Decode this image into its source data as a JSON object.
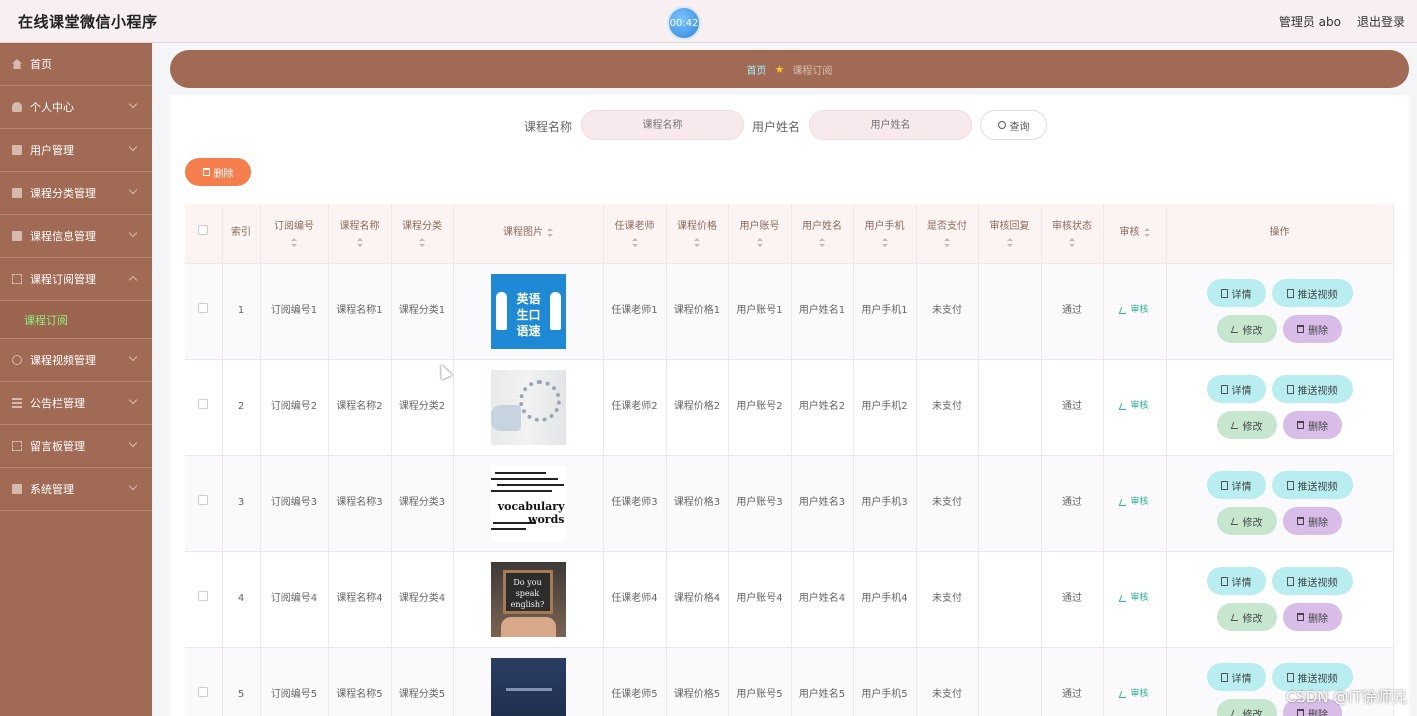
{
  "app": {
    "title": "在线课堂微信小程序",
    "timer": "00:42"
  },
  "header": {
    "user": "管理员 abo",
    "logout": "退出登录"
  },
  "sidebar": {
    "items": [
      {
        "label": "首页",
        "icon": "home-icon",
        "expandable": false
      },
      {
        "label": "个人中心",
        "icon": "user-icon",
        "expandable": true
      },
      {
        "label": "用户管理",
        "icon": "clipboard-icon",
        "expandable": true
      },
      {
        "label": "课程分类管理",
        "icon": "box-icon",
        "expandable": true
      },
      {
        "label": "课程信息管理",
        "icon": "stack-icon",
        "expandable": true
      },
      {
        "label": "课程订阅管理",
        "icon": "frame-icon",
        "expandable": true,
        "expanded": true,
        "children": [
          {
            "label": "课程订阅"
          }
        ]
      },
      {
        "label": "课程视频管理",
        "icon": "circle-icon",
        "expandable": true
      },
      {
        "label": "公告栏管理",
        "icon": "list-icon",
        "expandable": true
      },
      {
        "label": "留言板管理",
        "icon": "frame-icon",
        "expandable": true
      },
      {
        "label": "系统管理",
        "icon": "box-icon",
        "expandable": true
      }
    ],
    "active_child": "课程订阅"
  },
  "breadcrumb": {
    "home": "首页",
    "current": "课程订阅"
  },
  "search": {
    "course_label": "课程名称",
    "course_placeholder": "课程名称",
    "course_value": "",
    "user_label": "用户姓名",
    "user_placeholder": "用户姓名",
    "user_value": "",
    "button": "查询"
  },
  "toolbar": {
    "delete_label": "删除"
  },
  "table": {
    "headers": [
      "索引",
      "订阅编号",
      "课程名称",
      "课程分类",
      "课程图片",
      "任课老师",
      "课程价格",
      "用户账号",
      "用户姓名",
      "用户手机",
      "是否支付",
      "审核回复",
      "审核状态",
      "审核",
      "操作"
    ],
    "rows": [
      {
        "index": "1",
        "sub_no": "订阅编号1",
        "course": "课程名称1",
        "category": "课程分类1",
        "teacher": "任课老师1",
        "price": "课程价格1",
        "account": "用户账号1",
        "name": "用户姓名1",
        "phone": "用户手机1",
        "paid": "未支付",
        "reply": "",
        "status": "通过"
      },
      {
        "index": "2",
        "sub_no": "订阅编号2",
        "course": "课程名称2",
        "category": "课程分类2",
        "teacher": "任课老师2",
        "price": "课程价格2",
        "account": "用户账号2",
        "name": "用户姓名2",
        "phone": "用户手机2",
        "paid": "未支付",
        "reply": "",
        "status": "通过"
      },
      {
        "index": "3",
        "sub_no": "订阅编号3",
        "course": "课程名称3",
        "category": "课程分类3",
        "teacher": "任课老师3",
        "price": "课程价格3",
        "account": "用户账号3",
        "name": "用户姓名3",
        "phone": "用户手机3",
        "paid": "未支付",
        "reply": "",
        "status": "通过"
      },
      {
        "index": "4",
        "sub_no": "订阅编号4",
        "course": "课程名称4",
        "category": "课程分类4",
        "teacher": "任课老师4",
        "price": "课程价格4",
        "account": "用户账号4",
        "name": "用户姓名4",
        "phone": "用户手机4",
        "paid": "未支付",
        "reply": "",
        "status": "通过"
      },
      {
        "index": "5",
        "sub_no": "订阅编号5",
        "course": "课程名称5",
        "category": "课程分类5",
        "teacher": "任课老师5",
        "price": "课程价格5",
        "account": "用户账号5",
        "name": "用户姓名5",
        "phone": "用户手机5",
        "paid": "未支付",
        "reply": "",
        "status": "通过"
      }
    ],
    "audit_link": "审核",
    "actions": {
      "detail": "详情",
      "push": "推送视频",
      "edit": "修改",
      "delete": "删除"
    }
  },
  "thumb_text": {
    "t1": "英语生口语速",
    "t3": "vocabulary words",
    "t4": [
      "Do you",
      "speak",
      "english?"
    ]
  },
  "watermark": "CSDN @IT徐师兄",
  "colors": {
    "sidebar": "#a06a54",
    "accent_delete": "#f47e4c",
    "submenu_active": "#8ff07a",
    "crumb_home": "#9ff0ff",
    "audit_green": "#2bb592"
  }
}
